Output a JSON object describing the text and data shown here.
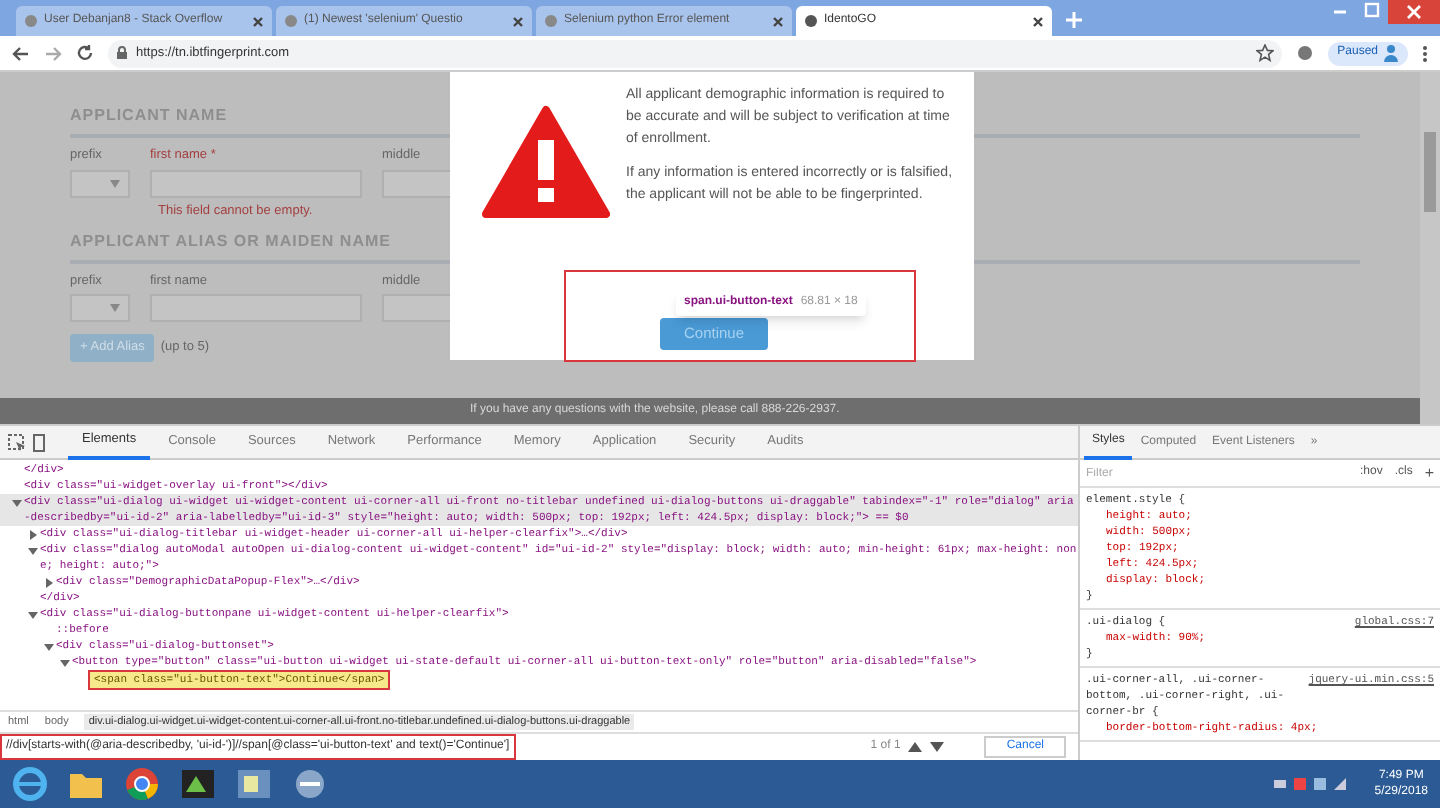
{
  "browser": {
    "tabs": [
      {
        "label": "User Debanjan8 - Stack Overflow",
        "selected": false
      },
      {
        "label": "(1) Newest 'selenium' Questio",
        "selected": false
      },
      {
        "label": "Selenium python Error element",
        "selected": false
      },
      {
        "label": "IdentoGO",
        "selected": true
      }
    ],
    "address": "https://tn.ibtfingerprint.com",
    "profile": "Paused"
  },
  "page": {
    "sections": [
      {
        "heading": "APPLICANT NAME",
        "labels": [
          "prefix",
          "first name *",
          "middle"
        ],
        "error": "This field cannot be empty."
      },
      {
        "heading": "APPLICANT ALIAS OR MAIDEN NAME",
        "labels": [
          "prefix",
          "first name",
          "middle"
        ]
      }
    ],
    "add_button": "+ Add Alias",
    "add_note": "(up to 5)",
    "footer": "If you have any questions with the website, please call 888-226-2937."
  },
  "dialog": {
    "paragraphs": [
      "All applicant demographic information is required to be accurate and will be subject to verification at time of enrollment.",
      "If any information is entered incorrectly or is falsified, the applicant will not be able to be fingerprinted."
    ],
    "button": "Continue",
    "tooltip": {
      "selector": "span.ui-button-text",
      "size": "68.81 × 18"
    }
  },
  "devtools": {
    "tabs": [
      {
        "label": "Elements",
        "selected": true
      },
      {
        "label": "Console",
        "selected": false
      },
      {
        "label": "Sources",
        "selected": false
      },
      {
        "label": "Network",
        "selected": false
      },
      {
        "label": "Performance",
        "selected": false
      },
      {
        "label": "Memory",
        "selected": false
      },
      {
        "label": "Application",
        "selected": false
      },
      {
        "label": "Security",
        "selected": false
      },
      {
        "label": "Audits",
        "selected": false
      }
    ],
    "dom": [
      {
        "text": "</div>",
        "selected": false,
        "highlighted": false
      },
      {
        "text": "<div class=\"ui-widget-overlay ui-front\"></div>",
        "selected": false,
        "highlighted": false
      },
      {
        "text": "<div class=\"ui-dialog ui-widget ui-widget-content ui-corner-all ui-front no-titlebar undefined ui-dialog-buttons ui-draggable\" tabindex=\"-1\" role=\"dialog\" aria-describedby=\"ui-id-2\" aria-labelledby=\"ui-id-3\" style=\"height: auto; width: 500px; top: 192px; left: 424.5px; display: block;\"> == $0",
        "expanded": true,
        "selected": true,
        "highlighted": false,
        "children": [
          {
            "text": "<div class=\"ui-dialog-titlebar ui-widget-header ui-corner-all ui-helper-clearfix\">…</div>",
            "expanded": false,
            "selected": false,
            "highlighted": false
          },
          {
            "text": "<div class=\"dialog autoModal autoOpen ui-dialog-content ui-widget-content\" id=\"ui-id-2\" style=\"display: block; width: auto; min-height: 61px; max-height: none; height: auto;\">",
            "expanded": true,
            "selected": false,
            "highlighted": false,
            "children": [
              {
                "text": "<div class=\"DemographicDataPopup-Flex\">…</div>",
                "expanded": false,
                "selected": false,
                "highlighted": false
              }
            ]
          },
          {
            "text": "</div>",
            "selected": false,
            "highlighted": false
          },
          {
            "text": "<div class=\"ui-dialog-buttonpane ui-widget-content ui-helper-clearfix\">",
            "expanded": true,
            "selected": false,
            "highlighted": false,
            "children": [
              {
                "text": "::before",
                "selected": false,
                "highlighted": false
              },
              {
                "text": "<div class=\"ui-dialog-buttonset\">",
                "expanded": true,
                "selected": false,
                "highlighted": false,
                "children": [
                  {
                    "text": "<button type=\"button\" class=\"ui-button ui-widget ui-state-default ui-corner-all ui-button-text-only\" role=\"button\" aria-disabled=\"false\">",
                    "expanded": true,
                    "selected": false,
                    "highlighted": false,
                    "children": [
                      {
                        "text": "<span class=\"ui-button-text\">Continue</span>",
                        "selected": false,
                        "highlighted": true
                      }
                    ]
                  }
                ]
              }
            ]
          }
        ]
      }
    ],
    "breadcrumbs": [
      "html",
      "body",
      "div.ui-dialog.ui-widget.ui-widget-content.ui-corner-all.ui-front.no-titlebar.undefined.ui-dialog-buttons.ui-draggable"
    ],
    "search": {
      "value": "//div[starts-with(@aria-describedby, 'ui-id-')]//span[@class='ui-button-text' and text()='Continue']",
      "count": "1 of 1",
      "cancel": "Cancel"
    },
    "styles": {
      "tabs": [
        {
          "label": "Styles",
          "selected": true
        },
        {
          "label": "Computed",
          "selected": false
        },
        {
          "label": "Event Listeners",
          "selected": false
        },
        {
          "label": "»",
          "selected": false
        }
      ],
      "filter_placeholder": "Filter",
      "hov": ":hov",
      "cls": ".cls",
      "add": "+",
      "rules": [
        {
          "selector": "element.style {",
          "props": [
            "height: auto;",
            "width: 500px;",
            "top: 192px;",
            "left: 424.5px;",
            "display: block;"
          ],
          "close": "}"
        },
        {
          "selector": ".ui-dialog {",
          "source": "global.css:7",
          "props": [
            "max-width: 90%;"
          ],
          "close": "}"
        },
        {
          "selector": ".ui-corner-all, .ui-corner-bottom, .ui-corner-right, .ui-corner-br {",
          "source": "jquery-ui.min.css:5",
          "props": [
            "border-bottom-right-radius: 4px;"
          ]
        }
      ]
    }
  },
  "taskbar": {
    "time": "7:49 PM",
    "date": "5/29/2018"
  }
}
